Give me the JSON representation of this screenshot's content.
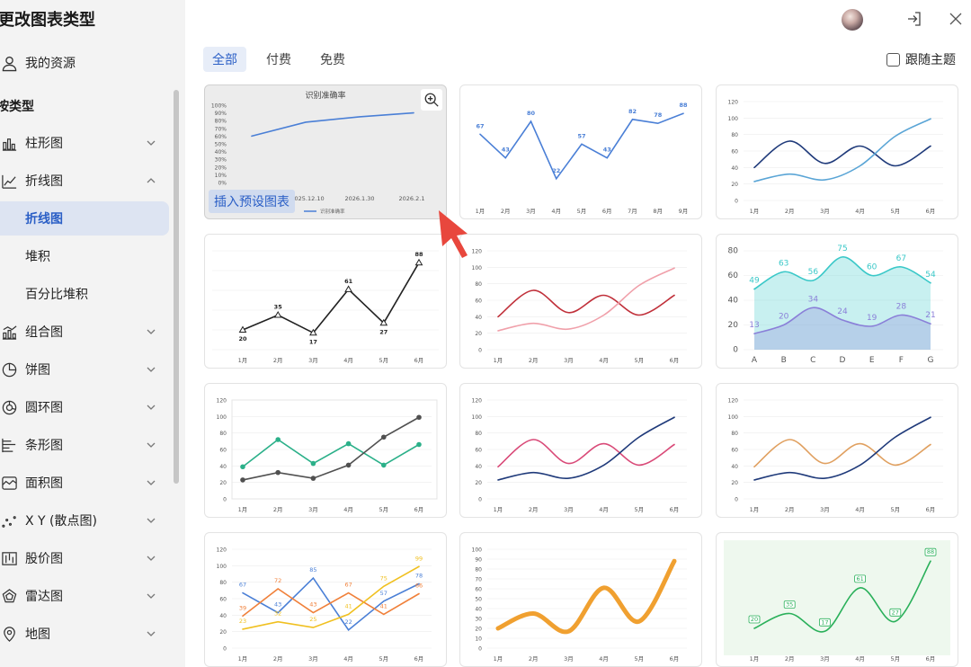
{
  "app": {
    "title": "更改图表类型"
  },
  "sidebar": {
    "my_resources": "我的资源",
    "section_label": "按类型",
    "categories": [
      {
        "label": "柱形图",
        "icon": "bar-chart-icon",
        "expanded": false
      },
      {
        "label": "折线图",
        "icon": "line-chart-icon",
        "expanded": true,
        "subitems": [
          "折线图",
          "堆积",
          "百分比堆积"
        ],
        "active_subitem": "折线图"
      },
      {
        "label": "组合图",
        "icon": "combo-chart-icon",
        "expanded": false
      },
      {
        "label": "饼图",
        "icon": "pie-chart-icon",
        "expanded": false
      },
      {
        "label": "圆环图",
        "icon": "donut-chart-icon",
        "expanded": false
      },
      {
        "label": "条形图",
        "icon": "horizontal-bar-icon",
        "expanded": false
      },
      {
        "label": "面积图",
        "icon": "area-chart-icon",
        "expanded": false
      },
      {
        "label": "X Y (散点图)",
        "icon": "scatter-chart-icon",
        "expanded": false
      },
      {
        "label": "股价图",
        "icon": "stock-chart-icon",
        "expanded": false
      },
      {
        "label": "雷达图",
        "icon": "radar-chart-icon",
        "expanded": false
      },
      {
        "label": "地图",
        "icon": "map-pin-icon",
        "expanded": false
      }
    ]
  },
  "filter": {
    "tabs": [
      "全部",
      "付费",
      "免费"
    ],
    "active": "全部",
    "follow_theme": "跟随主题",
    "follow_checked": false
  },
  "selected_card": {
    "insert_label": "插入预设图表"
  },
  "colors": {
    "accent": "#2b5fc6",
    "blue": "#4a7fd6",
    "navy": "#1f3a7a",
    "red": "#c0303a",
    "teal": "#3ac8c8",
    "purple": "#8a7fd8",
    "green": "#2ab05a",
    "orange": "#f0a030"
  },
  "chart_data": [
    {
      "type": "line",
      "title": "识别准确率",
      "x": [
        "2025.12.10",
        "2026.1.30",
        "2026.2.1"
      ],
      "ylim": [
        0,
        100
      ],
      "yticks": [
        "100%",
        "90%",
        "80%",
        "70%",
        "60%",
        "50%",
        "40%",
        "30%",
        "20%",
        "10%",
        "0%"
      ],
      "series": [
        {
          "name": "识别准确率",
          "values": [
            60,
            78,
            85,
            90
          ]
        }
      ]
    },
    {
      "type": "line",
      "categories": [
        "1月",
        "2月",
        "3月",
        "4月",
        "5月",
        "6月",
        "7月",
        "8月",
        "9月"
      ],
      "series": [
        {
          "values": [
            67,
            43,
            80,
            22,
            57,
            43,
            82,
            78,
            88
          ]
        }
      ]
    },
    {
      "type": "line",
      "categories": [
        "1月",
        "2月",
        "3月",
        "4月",
        "5月",
        "6月"
      ],
      "ylim": [
        0,
        120
      ],
      "yticks": [
        "120",
        "100",
        "80",
        "60",
        "40",
        "20",
        "0"
      ],
      "series": [
        {
          "values": [
            40,
            72,
            45,
            66,
            42,
            66
          ]
        },
        {
          "values": [
            23,
            32,
            25,
            42,
            78,
            99
          ]
        }
      ]
    },
    {
      "type": "line",
      "categories": [
        "1月",
        "2月",
        "3月",
        "4月",
        "5月",
        "6月"
      ],
      "series": [
        {
          "values": [
            20,
            35,
            17,
            61,
            27,
            88
          ]
        }
      ]
    },
    {
      "type": "line",
      "categories": [
        "1月",
        "2月",
        "3月",
        "4月",
        "5月",
        "6月"
      ],
      "ylim": [
        0,
        120
      ],
      "yticks": [
        "120",
        "100",
        "80",
        "60",
        "40",
        "20",
        "0"
      ],
      "series": [
        {
          "values": [
            40,
            72,
            45,
            66,
            42,
            66
          ]
        },
        {
          "values": [
            23,
            32,
            25,
            42,
            78,
            99
          ]
        }
      ]
    },
    {
      "type": "area",
      "categories": [
        "A",
        "B",
        "C",
        "D",
        "E",
        "F",
        "G"
      ],
      "ylim": [
        0,
        80
      ],
      "yticks": [
        "80",
        "60",
        "40",
        "20",
        "0"
      ],
      "series": [
        {
          "values": [
            49,
            63,
            56,
            75,
            60,
            67,
            54
          ]
        },
        {
          "values": [
            13,
            20,
            34,
            24,
            19,
            28,
            21
          ]
        }
      ]
    },
    {
      "type": "line",
      "categories": [
        "1月",
        "2月",
        "3月",
        "4月",
        "5月",
        "6月"
      ],
      "ylim": [
        0,
        120
      ],
      "yticks": [
        "120",
        "100",
        "80",
        "60",
        "40",
        "20",
        "0"
      ],
      "series": [
        {
          "values": [
            39,
            72,
            43,
            67,
            41,
            66
          ]
        },
        {
          "values": [
            23,
            32,
            25,
            41,
            75,
            99
          ]
        }
      ]
    },
    {
      "type": "line",
      "categories": [
        "1月",
        "2月",
        "3月",
        "4月",
        "5月",
        "6月"
      ],
      "ylim": [
        0,
        120
      ],
      "yticks": [
        "120",
        "100",
        "80",
        "60",
        "40",
        "20",
        "0"
      ],
      "series": [
        {
          "values": [
            39,
            72,
            43,
            67,
            41,
            66
          ]
        },
        {
          "values": [
            23,
            32,
            25,
            41,
            75,
            99
          ]
        }
      ]
    },
    {
      "type": "line",
      "categories": [
        "1月",
        "2月",
        "3月",
        "4月",
        "5月",
        "6月"
      ],
      "ylim": [
        0,
        120
      ],
      "yticks": [
        "120",
        "100",
        "80",
        "60",
        "40",
        "20",
        "0"
      ],
      "series": [
        {
          "values": [
            39,
            72,
            43,
            67,
            41,
            66
          ]
        },
        {
          "values": [
            23,
            32,
            25,
            41,
            75,
            99
          ]
        }
      ]
    },
    {
      "type": "line",
      "categories": [
        "1月",
        "2月",
        "3月",
        "4月",
        "5月",
        "6月"
      ],
      "ylim": [
        0,
        120
      ],
      "yticks": [
        "120",
        "100",
        "80",
        "60",
        "40",
        "20",
        "0"
      ],
      "series": [
        {
          "values": [
            67,
            43,
            85,
            22,
            57,
            78
          ]
        },
        {
          "values": [
            39,
            72,
            43,
            67,
            41,
            66
          ]
        },
        {
          "values": [
            23,
            32,
            25,
            41,
            75,
            99
          ]
        }
      ]
    },
    {
      "type": "line",
      "categories": [
        "1月",
        "2月",
        "3月",
        "4月",
        "5月",
        "6月"
      ],
      "ylim": [
        0,
        100
      ],
      "yticks": [
        "100",
        "90",
        "80",
        "70",
        "60",
        "50",
        "40",
        "30",
        "20",
        "10",
        "0"
      ],
      "series": [
        {
          "values": [
            20,
            35,
            17,
            61,
            27,
            88
          ]
        }
      ]
    },
    {
      "type": "line",
      "categories": [
        "1月",
        "2月",
        "3月",
        "4月",
        "5月",
        "6月"
      ],
      "series": [
        {
          "values": [
            20,
            35,
            17,
            61,
            27,
            88
          ]
        }
      ]
    }
  ]
}
